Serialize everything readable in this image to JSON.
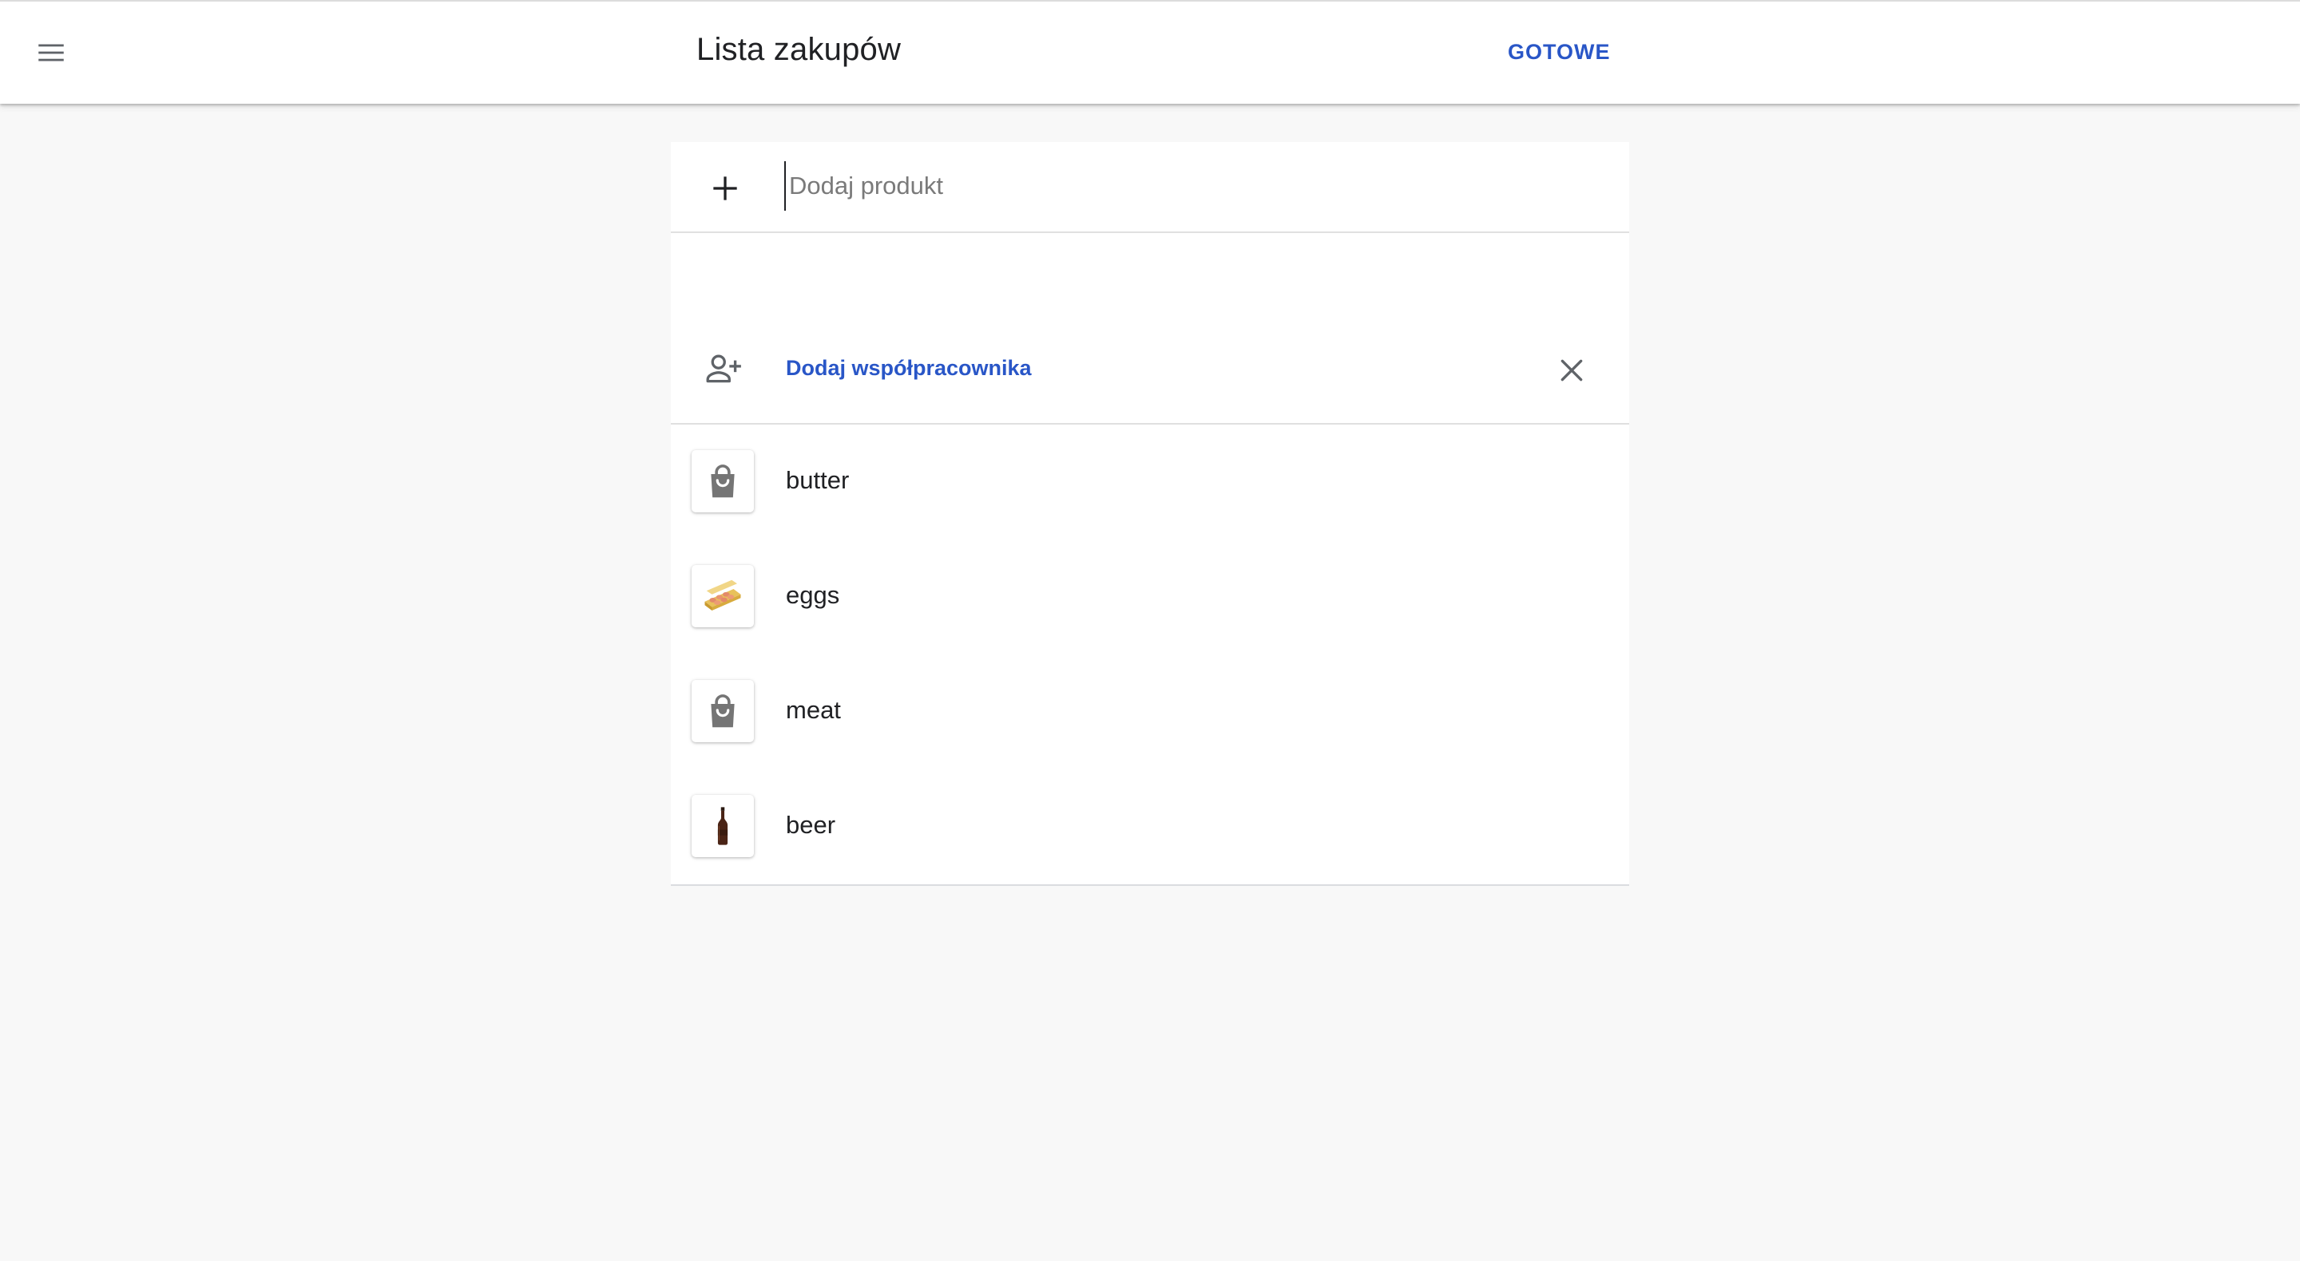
{
  "header": {
    "title": "Lista zakupów",
    "done_label": "GOTOWE",
    "menu_icon": "menu-icon"
  },
  "add_product": {
    "placeholder": "Dodaj produkt",
    "value": "",
    "icon": "plus-icon"
  },
  "collaborator": {
    "label": "Dodaj współpracownika",
    "icon": "person-add-icon",
    "close_icon": "close-icon"
  },
  "items": [
    {
      "name": "butter",
      "image": "shopping-bag-icon"
    },
    {
      "name": "eggs",
      "image": "eggs-image"
    },
    {
      "name": "meat",
      "image": "shopping-bag-icon"
    },
    {
      "name": "beer",
      "image": "beer-bottle-image"
    }
  ],
  "colors": {
    "accent": "#2956c7",
    "background": "#f8f8f8",
    "surface": "#ffffff",
    "icon_gray": "#757575",
    "divider": "#e0e0e0"
  }
}
